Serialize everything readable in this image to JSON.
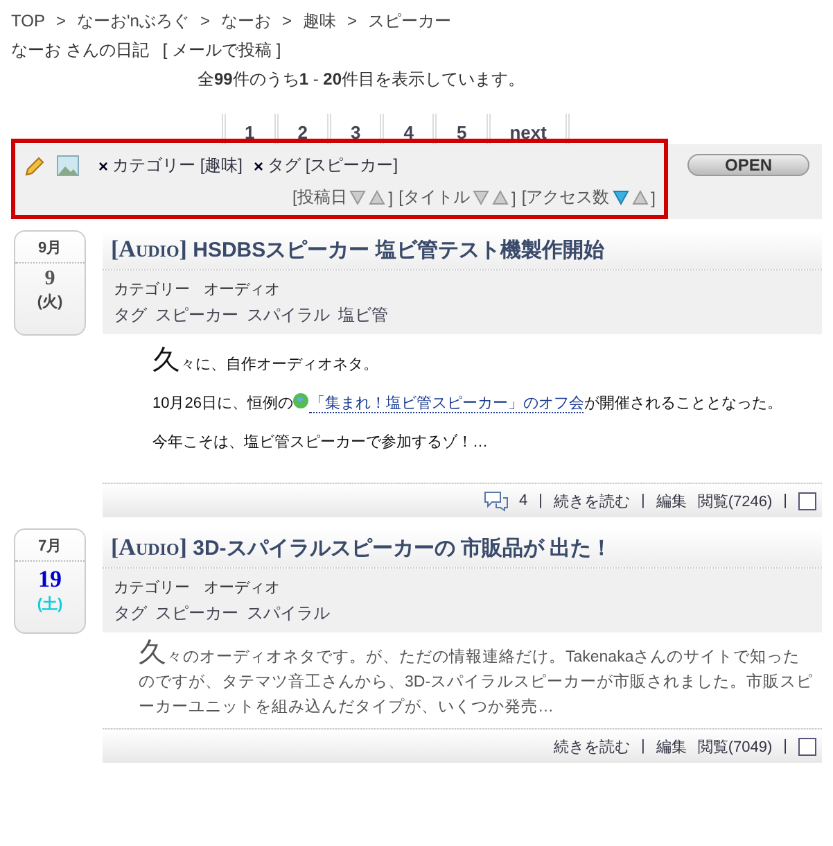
{
  "breadcrumb": {
    "separator": ">",
    "items": [
      "TOP",
      "なーお'nぶろぐ",
      "なーお",
      "趣味",
      "スピーカー"
    ]
  },
  "diary": {
    "title": "なーお さんの日記",
    "mail_link": "[ メールで投稿 ]"
  },
  "result_summary": "全**99**件のうち**1** - **20**件目を表示しています。",
  "pagination": [
    "1",
    "2",
    "3",
    "4",
    "5",
    "next"
  ],
  "filter_panel": {
    "filters": [
      {
        "remove": "×",
        "label": "カテゴリー [趣味]"
      },
      {
        "remove": "×",
        "label": "タグ [スピーカー]"
      }
    ],
    "sorts": [
      {
        "label": "[投稿日",
        "descending_selected": false,
        "ascending_selected": false,
        "close": "]"
      },
      {
        "label": "[タイトル",
        "descending_selected": false,
        "ascending_selected": false,
        "close": "]"
      },
      {
        "label": "[アクセス数",
        "descending_selected": true,
        "ascending_selected": false,
        "close": "]"
      }
    ],
    "open_button": "OPEN"
  },
  "entries": [
    {
      "month": "9月",
      "day": "9",
      "weekday": "(火)",
      "saturday": false,
      "title_tag": "[Audio]",
      "title": "HSDBSスピーカー 塩ビ管テスト機製作開始",
      "category_label": "カテゴリー",
      "category": "オーディオ",
      "tag_label": "タグ",
      "tags": [
        "スピーカー",
        "スパイラル",
        "塩ビ管"
      ],
      "summary_style": false,
      "drop_cap": "久",
      "paragraphs": [
        {
          "before": "々に、自作オーディオネタ。"
        },
        {
          "before": "10月26日に、恒例の",
          "link": "「集まれ！塩ビ管スピーカー」のオフ会",
          "after": "が開催されることとなった。"
        },
        {
          "before": "今年こそは、塩ビ管スピーカーで参加するゾ！…"
        }
      ],
      "comments": "4",
      "read_more": "続きを読む",
      "edit": "編集",
      "views": "閲覧(7246)",
      "separator": "|",
      "checked": false
    },
    {
      "month": "7月",
      "day": "19",
      "weekday": "(土)",
      "saturday": true,
      "title_tag": "[Audio]",
      "title": "3D-スパイラルスピーカーの 市販品が 出た！",
      "category_label": "カテゴリー",
      "category": "オーディオ",
      "tag_label": "タグ",
      "tags": [
        "スピーカー",
        "スパイラル"
      ],
      "summary_style": true,
      "drop_cap": "久",
      "paragraphs": [
        {
          "before": "々のオーディオネタです。が、ただの情報連絡だけ。Takenakaさんのサイトで知ったのですが、タテマツ音工さんから、3D-スパイラルスピーカーが市販されました。市販スピーカーユニットを組み込んだタイプが、いくつか発売…"
        }
      ],
      "read_more": "続きを読む",
      "edit": "編集",
      "views": "閲覧(7049)",
      "separator": "|",
      "checked": false
    }
  ]
}
